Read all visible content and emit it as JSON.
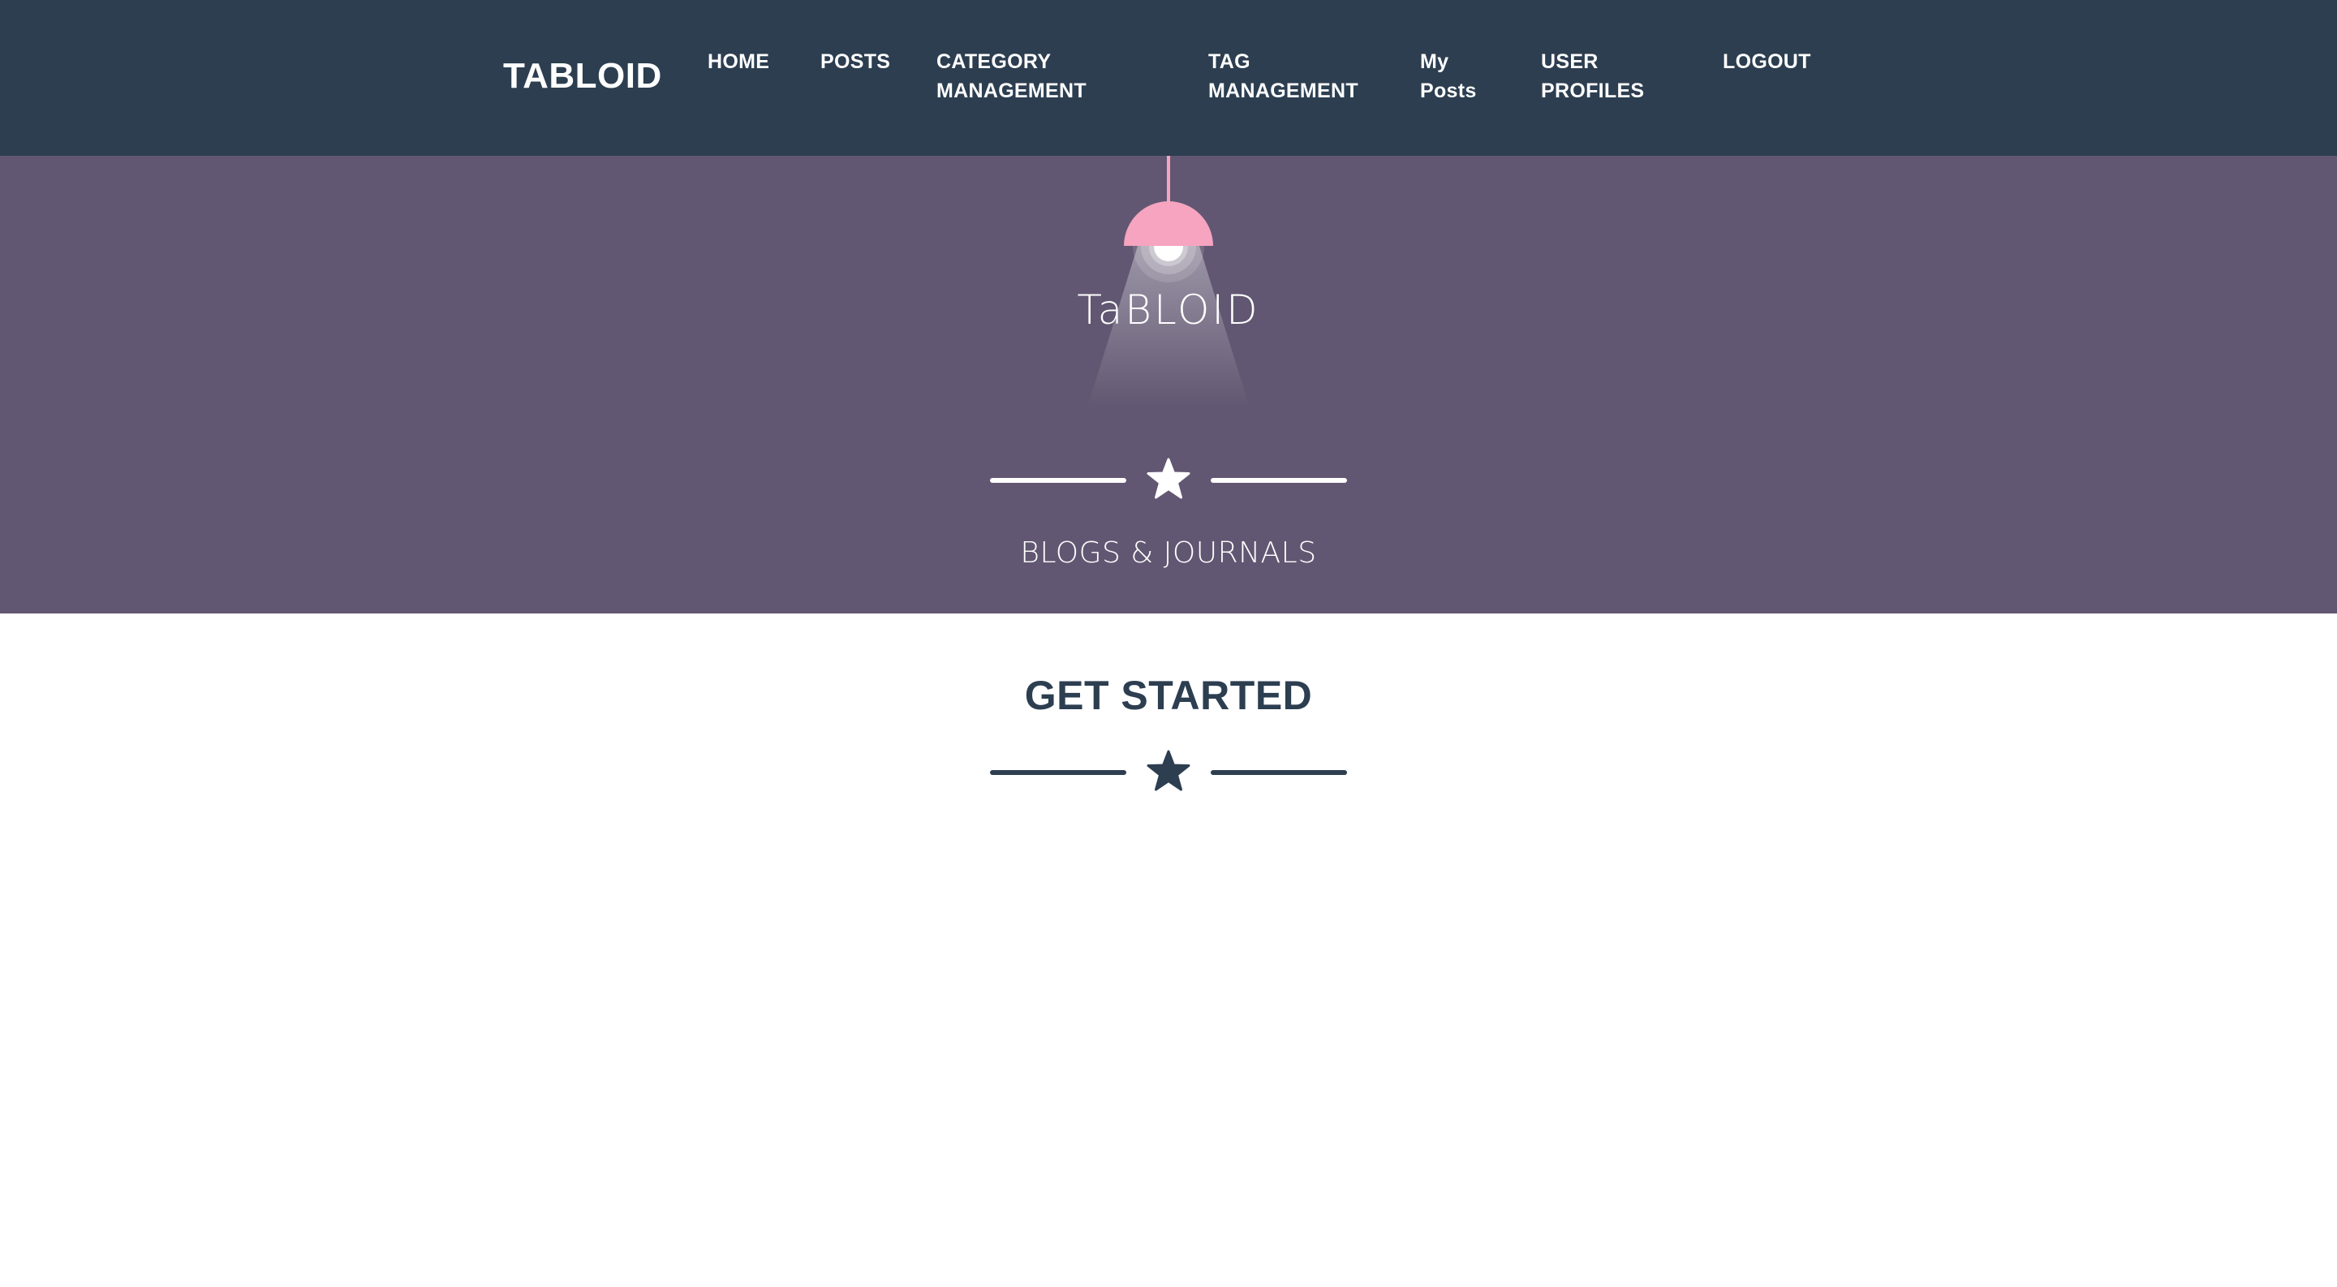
{
  "navbar": {
    "brand": "TABLOID",
    "links": [
      {
        "lines": [
          "HOME"
        ]
      },
      {
        "lines": [
          "POSTS"
        ]
      },
      {
        "lines": [
          "CATEGORY",
          "MANAGEMENT"
        ]
      },
      {
        "lines": [
          "TAG",
          "MANAGEMENT"
        ]
      },
      {
        "lines": [
          "My",
          "Posts"
        ]
      },
      {
        "lines": [
          "USER",
          "PROFILES"
        ]
      },
      {
        "lines": [
          "LOGOUT"
        ]
      }
    ]
  },
  "masthead": {
    "logo_text": "TaBLOID",
    "tagline": "BLOGS & JOURNALS",
    "divider_icon": "star-icon"
  },
  "main": {
    "section_title": "GET STARTED",
    "divider_icon": "star-icon"
  },
  "colors": {
    "navbar_bg": "#2c3e50",
    "masthead_bg": "#625772",
    "lamp_pink": "#f6a4bf",
    "text_dark": "#2c3e50",
    "white": "#ffffff"
  }
}
